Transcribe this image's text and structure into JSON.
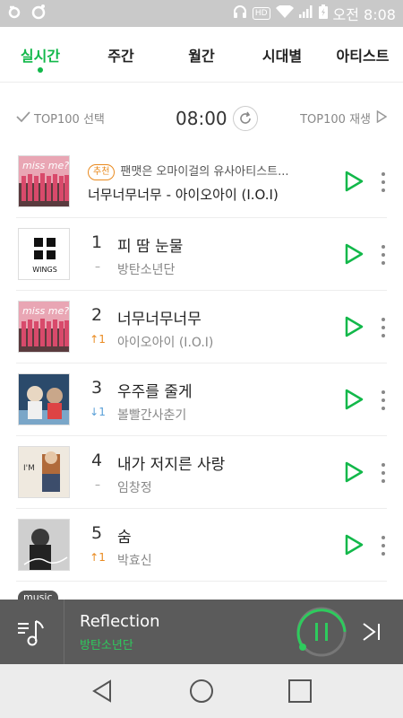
{
  "status_bar": {
    "hd": "HD",
    "time": "오전 8:08"
  },
  "tabs": [
    {
      "label": "실시간",
      "active": true
    },
    {
      "label": "주간",
      "active": false
    },
    {
      "label": "월간",
      "active": false
    },
    {
      "label": "시대별",
      "active": false
    },
    {
      "label": "아티스트",
      "active": false
    }
  ],
  "controls": {
    "select_label": "TOP100 선택",
    "time": "08:00",
    "play_all_label": "TOP100 재생"
  },
  "recommendation": {
    "badge": "추천",
    "description": "팬맷은 오마이걸의 유사아티스트...",
    "title": "너무너무너무 - 아이오아이 (I.O.I)"
  },
  "chart": [
    {
      "rank": "1",
      "change": "–",
      "change_type": "same",
      "title": "피 땀 눈물",
      "artist": "방탄소년단",
      "art": "wings"
    },
    {
      "rank": "2",
      "change": "↑1",
      "change_type": "up",
      "title": "너무너무너무",
      "artist": "아이오아이 (I.O.I)",
      "art": "ioi"
    },
    {
      "rank": "3",
      "change": "↓1",
      "change_type": "down",
      "title": "우주를 줄게",
      "artist": "볼빨간사춘기",
      "art": "bol4"
    },
    {
      "rank": "4",
      "change": "–",
      "change_type": "same",
      "title": "내가 저지른 사랑",
      "artist": "임창정",
      "art": "lim"
    },
    {
      "rank": "5",
      "change": "↑1",
      "change_type": "up",
      "title": "숨",
      "artist": "박효신",
      "art": "park"
    }
  ],
  "player": {
    "tag": "music",
    "title": "Reflection",
    "artist": "방탄소년단"
  },
  "colors": {
    "accent": "#12b84a",
    "up": "#e98a1f",
    "down": "#5aa0d8"
  },
  "icons": [
    "checkmark-icon",
    "refresh-icon",
    "play-icon",
    "more-vertical-icon",
    "playlist-icon",
    "pause-icon",
    "next-icon",
    "back-icon",
    "home-icon",
    "recents-icon"
  ]
}
